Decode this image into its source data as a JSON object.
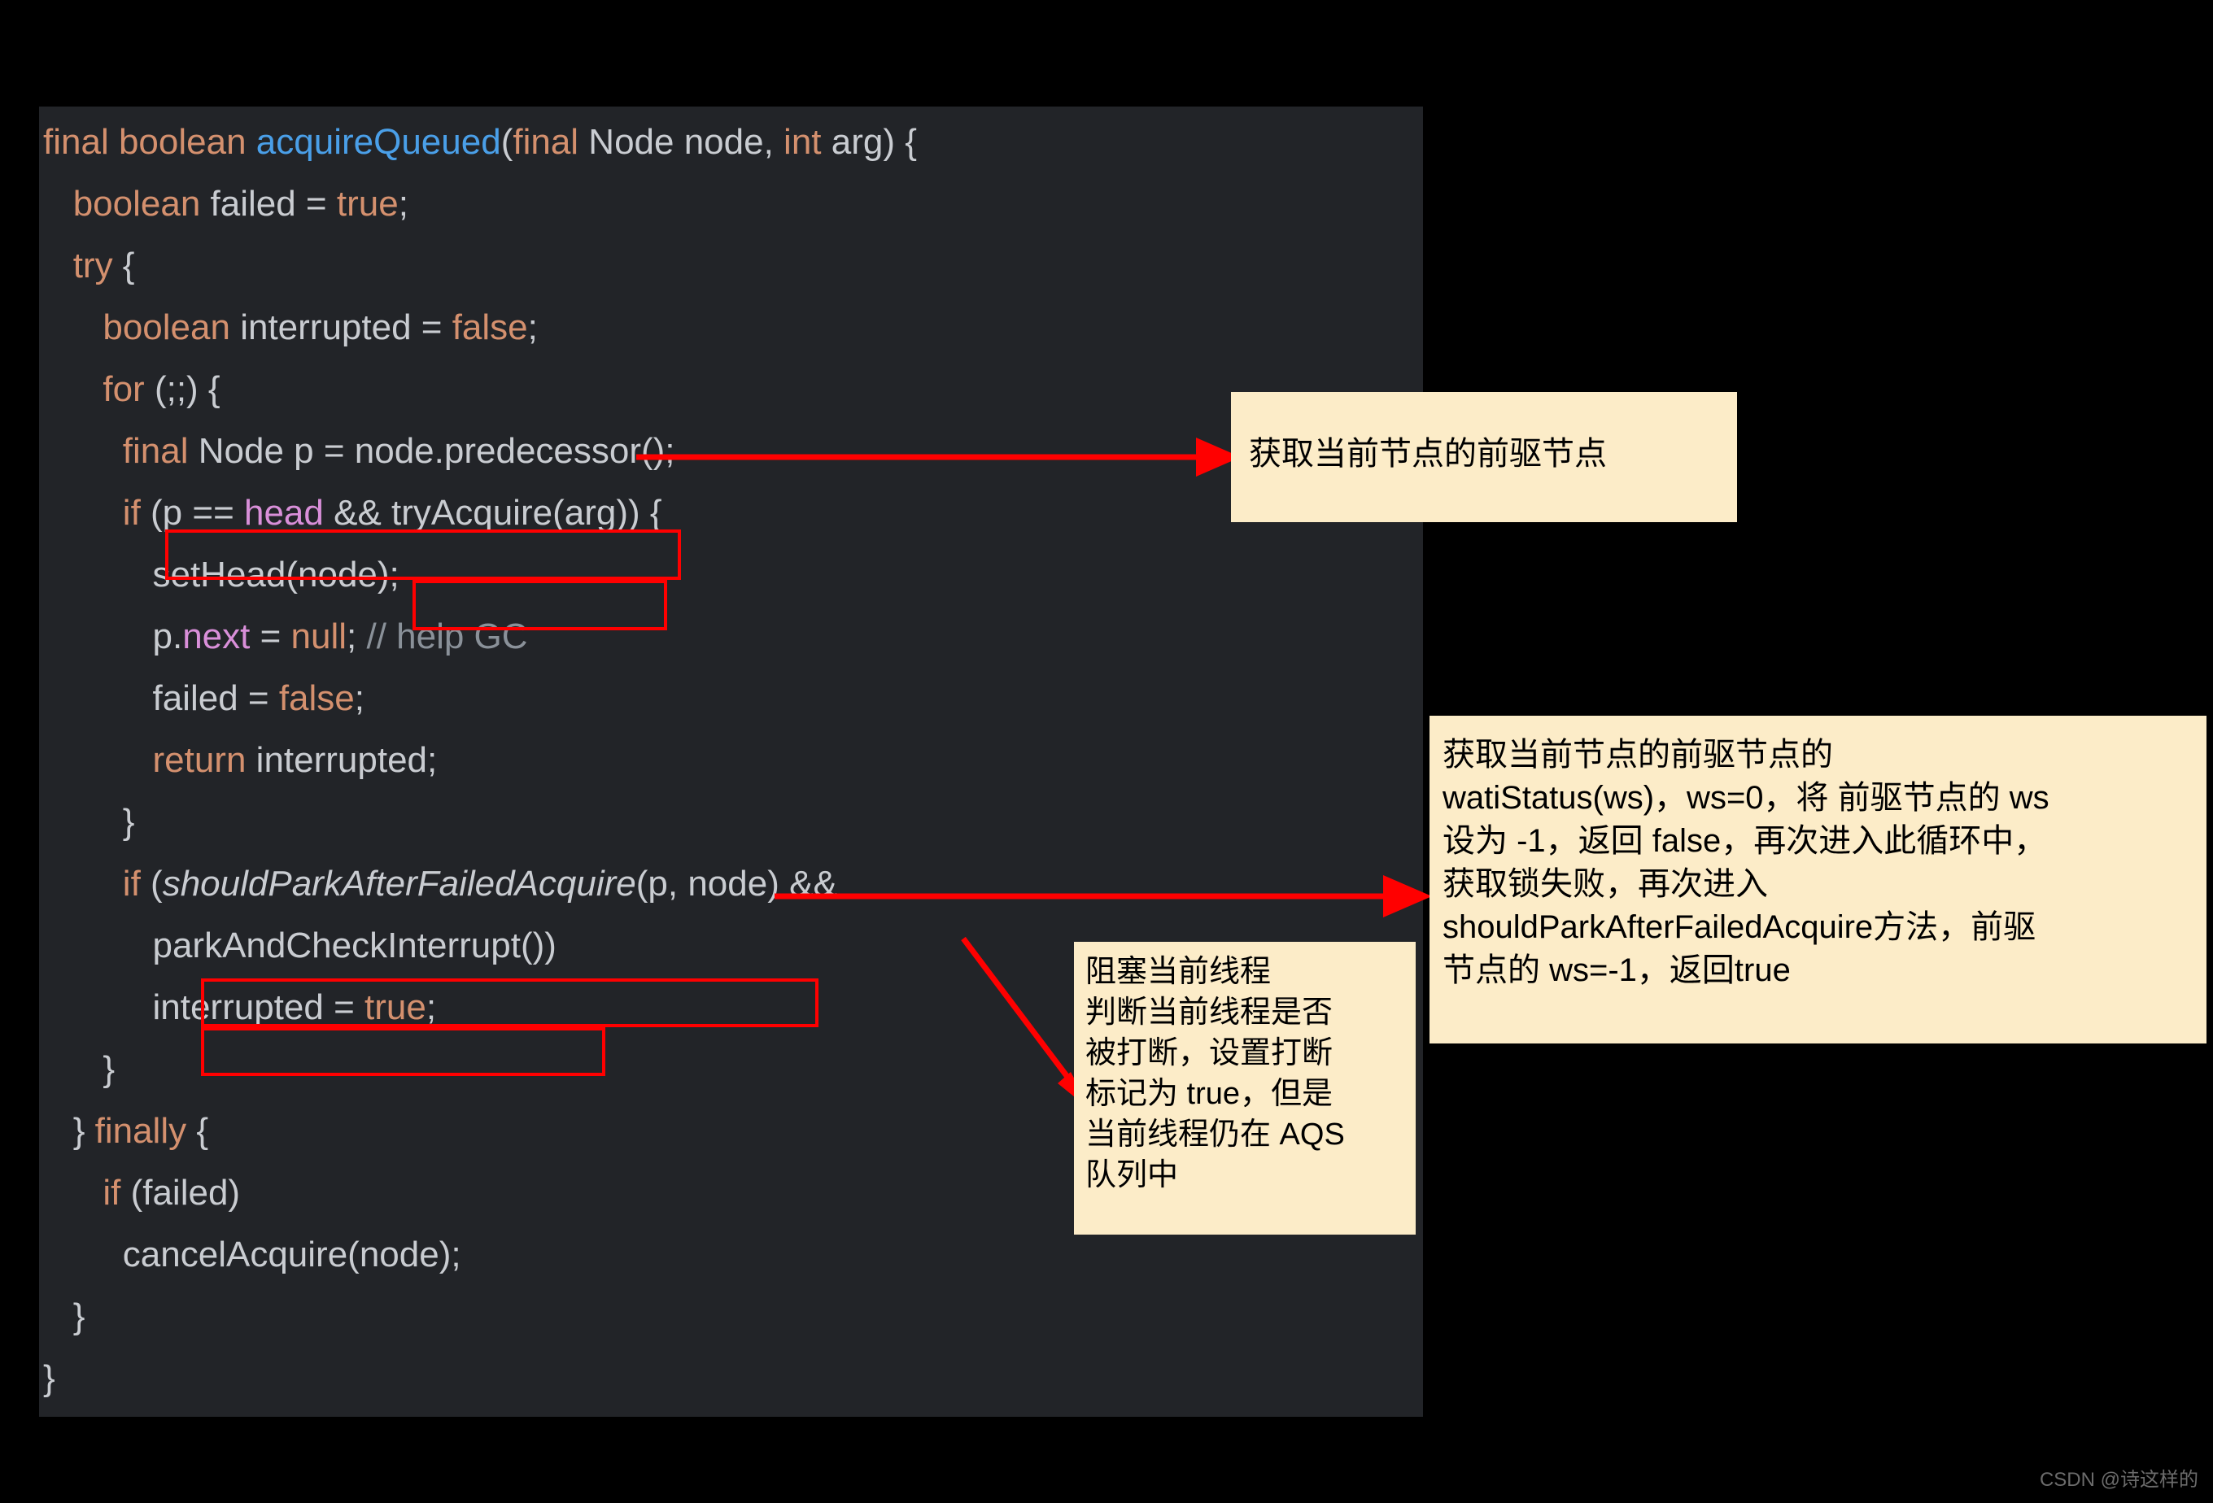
{
  "page": {
    "background_color": "#000000",
    "watermark": "CSDN @诗这样的"
  },
  "code_panel": {
    "background_color": "#222428",
    "language": "java",
    "colors": {
      "keyword": "#d4906e",
      "method_declaration": "#4a9fe8",
      "field": "#d98fd9",
      "comment": "#8a9199",
      "plain": "#c9ccd1",
      "highlight_box": "#ff0000"
    },
    "lines": [
      "final boolean acquireQueued(final Node node, int arg) {",
      "    boolean failed = true;",
      "    try {",
      "        boolean interrupted = false;",
      "        for (;;) {",
      "            final Node p = node.predecessor();",
      "            if (p == head && tryAcquire(arg)) {",
      "                setHead(node);",
      "                p.next = null; // help GC",
      "                failed = false;",
      "                return interrupted;",
      "            }",
      "            if (shouldParkAfterFailedAcquire(p, node) &&",
      "                parkAndCheckInterrupt())",
      "                interrupted = true;",
      "        }",
      "    } finally {",
      "        if (failed)",
      "            cancelAcquire(node);",
      "    }",
      "}"
    ]
  },
  "highlights": [
    {
      "name": "predecessor-line",
      "label": "final Node p = node.predecessor();"
    },
    {
      "name": "tryacquire-call",
      "label": "tryAcquire(arg))"
    },
    {
      "name": "shouldpark-line",
      "label": "shouldParkAfterFailedAcquire(p, node) &&"
    },
    {
      "name": "parkcheck-line",
      "label": "parkAndCheckInterrupt())"
    }
  ],
  "callouts": {
    "predecessor": "获取当前节点的前驱节点",
    "waitstatus": "获取当前节点的前驱节点的\nwatiStatus(ws)，ws=0，将 前驱节点的 ws\n设为 -1，返回 false，再次进入此循环中，\n获取锁失败，再次进入\nshouldParkAfterFailedAcquire方法，前驱\n节点的 ws=-1，返回true",
    "park": "阻塞当前线程\n判断当前线程是否\n被打断，设置打断\n标记为 true，但是\n当前线程仍在 AQS\n队列中"
  }
}
